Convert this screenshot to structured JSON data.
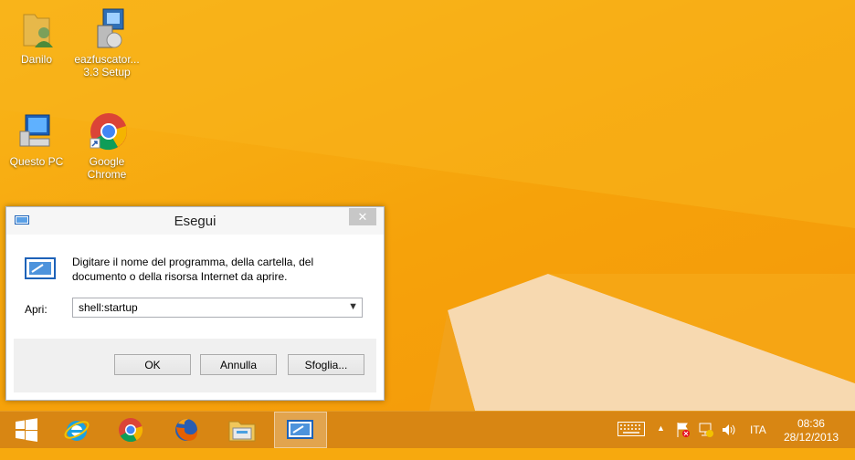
{
  "desktop": {
    "icons": [
      {
        "label": "Danilo",
        "icon": "user-folder-icon"
      },
      {
        "label": "eazfuscator... 3.3 Setup",
        "icon": "installer-icon"
      },
      {
        "label": "Questo PC",
        "icon": "computer-icon"
      },
      {
        "label": "Google Chrome",
        "icon": "chrome-icon"
      }
    ]
  },
  "dialog": {
    "title": "Esegui",
    "close_label": "✕",
    "description": "Digitare il nome del programma, della cartella, del documento o della risorsa Internet da aprire.",
    "open_label": "Apri:",
    "open_value": "shell:startup",
    "buttons": {
      "ok": "OK",
      "cancel": "Annulla",
      "browse": "Sfoglia..."
    }
  },
  "taskbar": {
    "items": [
      "start-icon",
      "internet-explorer-icon",
      "chrome-icon",
      "firefox-icon",
      "file-explorer-icon",
      "run-dialog-icon"
    ],
    "tray": {
      "language": "ITA",
      "time": "08:36",
      "date": "28/12/2013",
      "up_arrow": "▲"
    }
  },
  "colors": {
    "accent": "#f7a90e",
    "taskbar": "#d68414"
  }
}
